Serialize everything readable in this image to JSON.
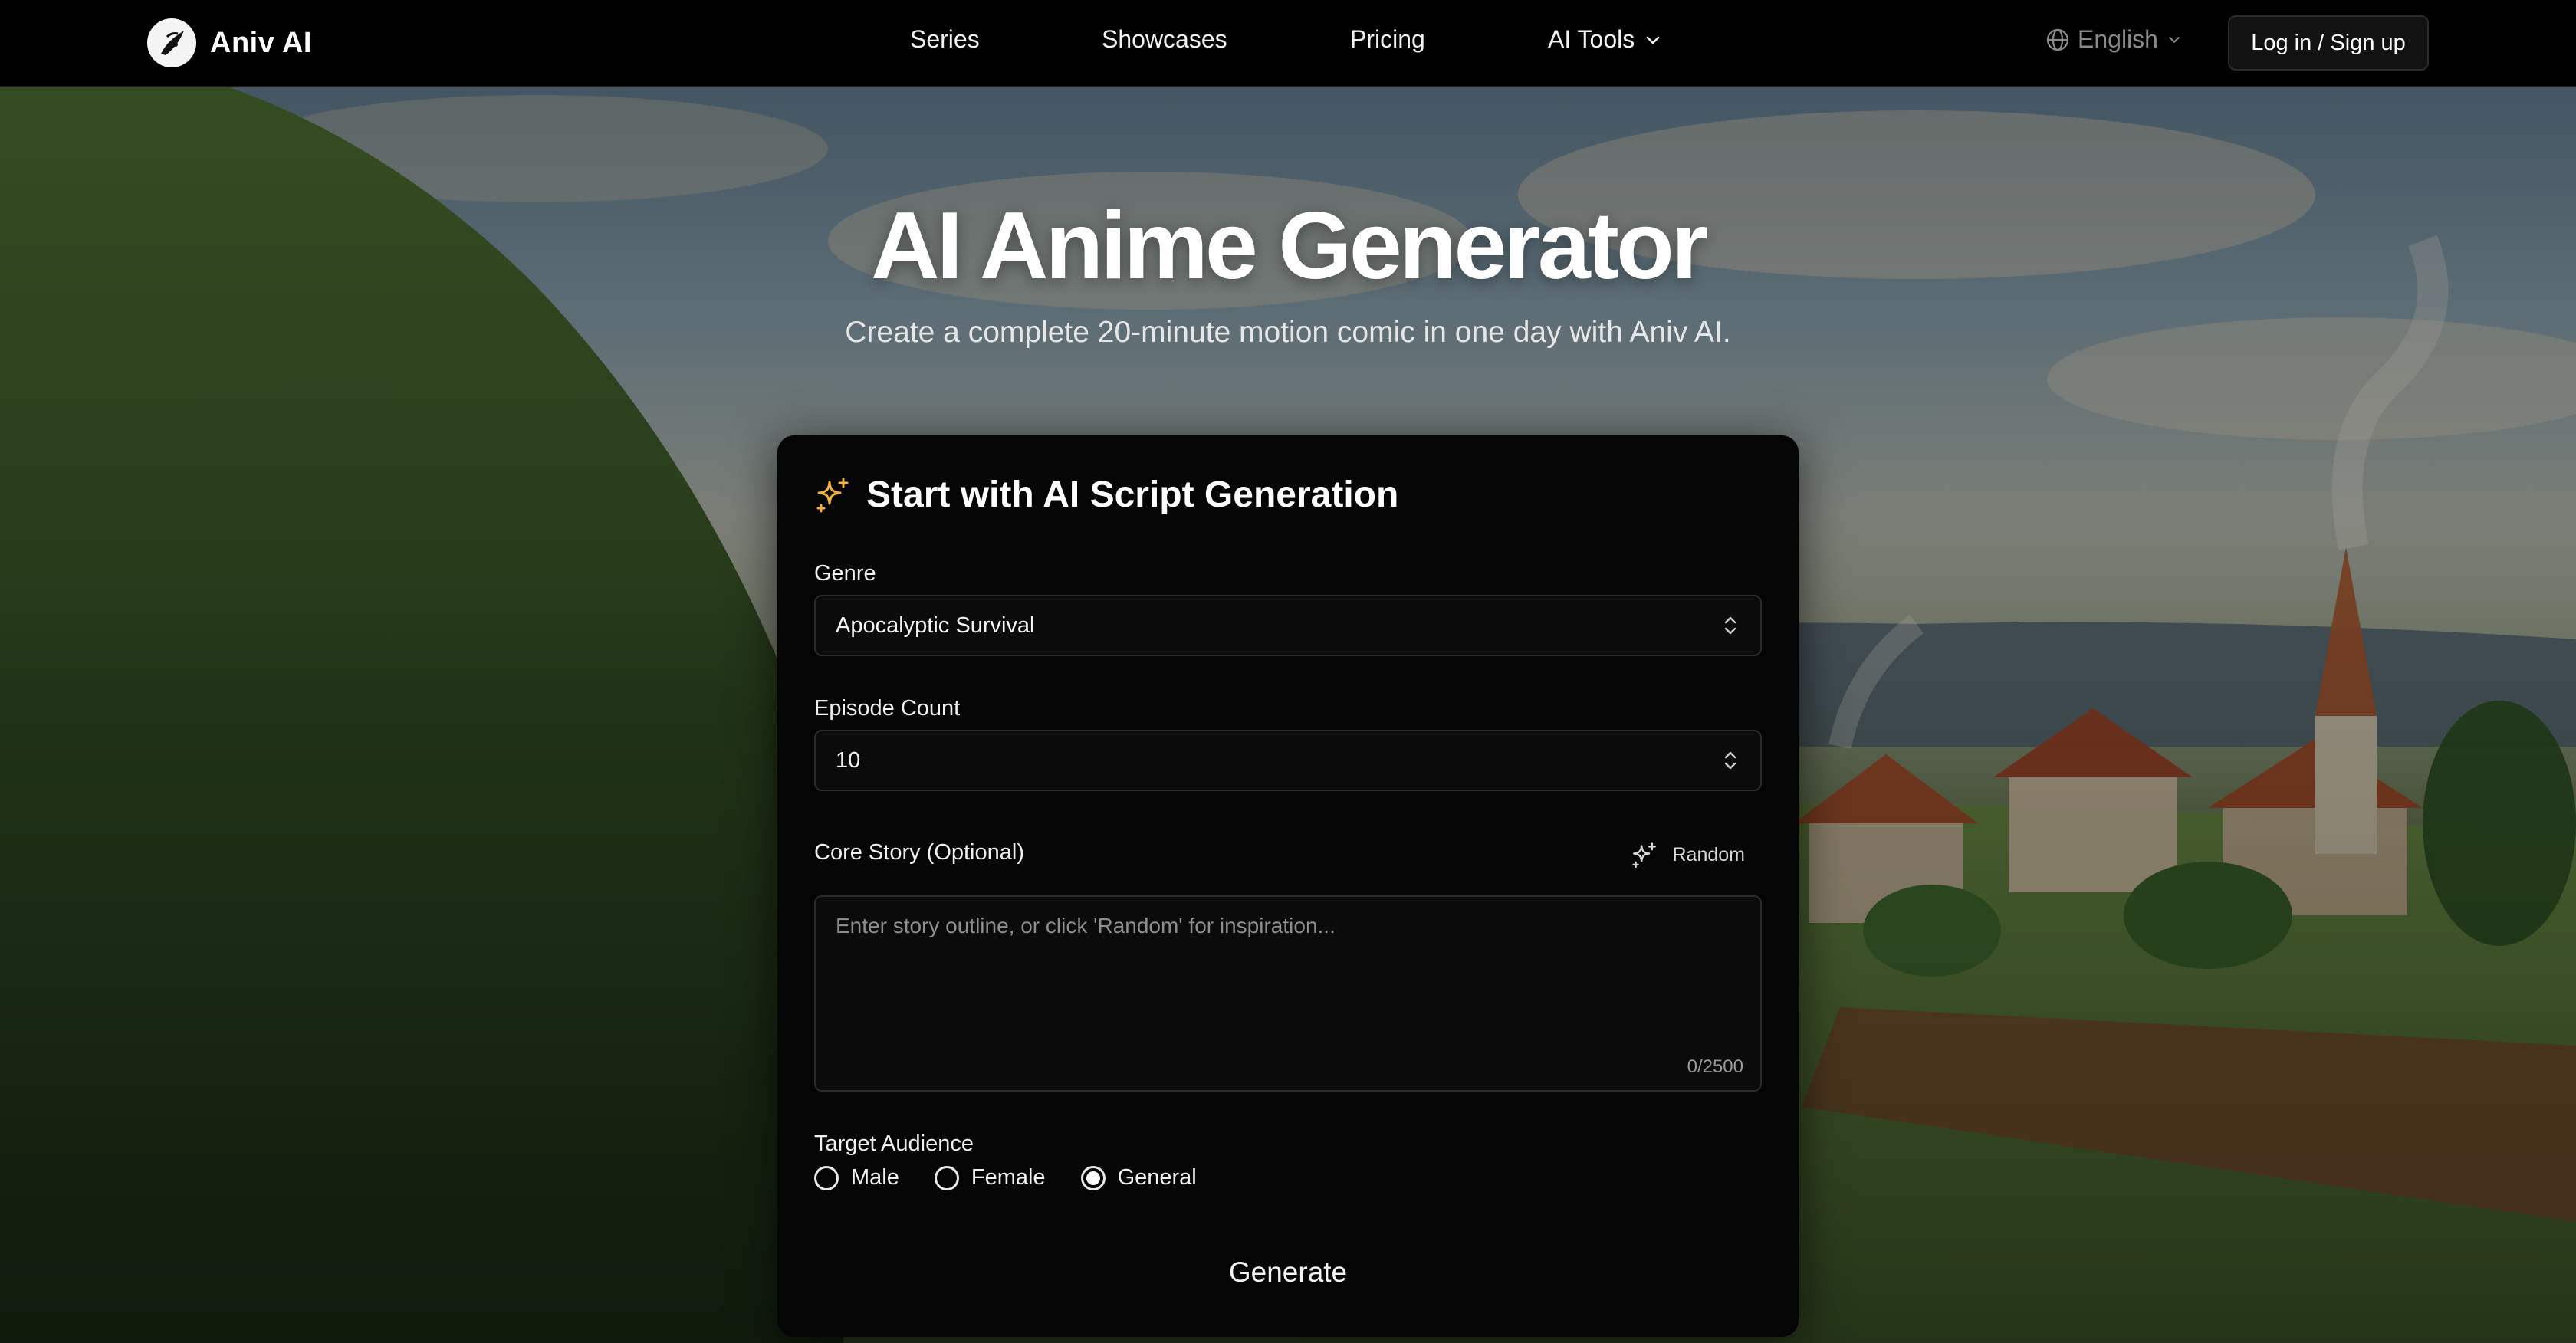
{
  "header": {
    "brand_name": "Aniv AI",
    "nav": [
      {
        "label": "Series"
      },
      {
        "label": "Showcases"
      },
      {
        "label": "Pricing"
      },
      {
        "label": "AI Tools"
      }
    ],
    "language": "English",
    "login_label": "Log in / Sign up"
  },
  "hero": {
    "title": "AI Anime Generator",
    "subtitle": "Create a complete 20-minute motion comic in one day with Aniv AI."
  },
  "card": {
    "title": "Start with AI Script Generation",
    "genre": {
      "label": "Genre",
      "value": "Apocalyptic Survival"
    },
    "episode_count": {
      "label": "Episode Count",
      "value": "10"
    },
    "core_story": {
      "label": "Core Story (Optional)",
      "random_label": "Random",
      "placeholder": "Enter story outline, or click 'Random' for inspiration...",
      "counter": "0/2500"
    },
    "audience": {
      "label": "Target Audience",
      "options": [
        "Male",
        "Female",
        "General"
      ],
      "selected": "General"
    },
    "generate_label": "Generate"
  },
  "colors": {
    "accent_icon": "#f5b431",
    "card_bg": "#050505",
    "header_bg": "#000000"
  },
  "icons": [
    "anime-logo-icon",
    "chevron-down-icon",
    "globe-icon",
    "sparkles-icon",
    "chevron-updown-icon"
  ]
}
